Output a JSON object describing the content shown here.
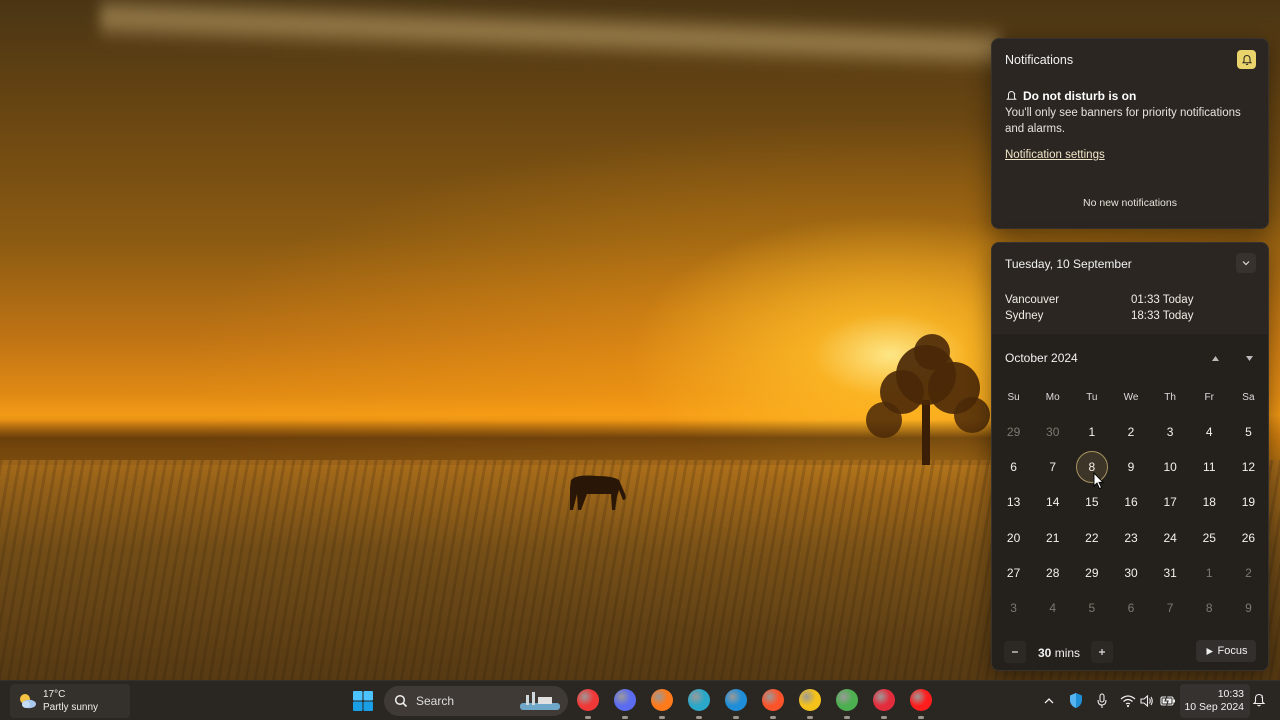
{
  "notifications": {
    "title": "Notifications",
    "dnd_heading": "Do not disturb is on",
    "dnd_description": "You'll only see banners for priority notifications and alarms.",
    "settings_link": "Notification settings",
    "empty_text": "No new notifications",
    "dnd_toggle_color": "#e9d36b"
  },
  "calendar": {
    "date_header": "Tuesday, 10 September",
    "clocks": [
      {
        "city": "Vancouver",
        "time": "01:33 Today"
      },
      {
        "city": "Sydney",
        "time": "18:33 Today"
      }
    ],
    "month_title": "October 2024",
    "weekdays": [
      "Su",
      "Mo",
      "Tu",
      "We",
      "Th",
      "Fr",
      "Sa"
    ],
    "weeks": [
      [
        {
          "d": "29",
          "m": true
        },
        {
          "d": "30",
          "m": true
        },
        {
          "d": "1"
        },
        {
          "d": "2"
        },
        {
          "d": "3"
        },
        {
          "d": "4"
        },
        {
          "d": "5"
        }
      ],
      [
        {
          "d": "6"
        },
        {
          "d": "7"
        },
        {
          "d": "8",
          "sel": true
        },
        {
          "d": "9"
        },
        {
          "d": "10"
        },
        {
          "d": "11"
        },
        {
          "d": "12"
        }
      ],
      [
        {
          "d": "13"
        },
        {
          "d": "14"
        },
        {
          "d": "15"
        },
        {
          "d": "16"
        },
        {
          "d": "17"
        },
        {
          "d": "18"
        },
        {
          "d": "19"
        }
      ],
      [
        {
          "d": "20"
        },
        {
          "d": "21"
        },
        {
          "d": "22"
        },
        {
          "d": "23"
        },
        {
          "d": "24"
        },
        {
          "d": "25"
        },
        {
          "d": "26"
        }
      ],
      [
        {
          "d": "27"
        },
        {
          "d": "28"
        },
        {
          "d": "29"
        },
        {
          "d": "30"
        },
        {
          "d": "31"
        },
        {
          "d": "1",
          "m": true
        },
        {
          "d": "2",
          "m": true
        }
      ],
      [
        {
          "d": "3",
          "m": true
        },
        {
          "d": "4",
          "m": true
        },
        {
          "d": "5",
          "m": true
        },
        {
          "d": "6",
          "m": true
        },
        {
          "d": "7",
          "m": true
        },
        {
          "d": "8",
          "m": true
        },
        {
          "d": "9",
          "m": true
        }
      ]
    ],
    "focus": {
      "value": "30",
      "unit": "mins",
      "button_label": "Focus"
    }
  },
  "taskbar": {
    "weather": {
      "temp": "17°C",
      "condition": "Partly sunny",
      "icon": "partly-sunny-icon"
    },
    "search_placeholder": "Search",
    "pinned_apps": [
      {
        "name": "vivaldi",
        "color": "#ef3939"
      },
      {
        "name": "firefox-dev",
        "color": "#5b6cf0"
      },
      {
        "name": "firefox",
        "color": "#ff7a1a"
      },
      {
        "name": "edge-dev",
        "color": "#2ba7c9"
      },
      {
        "name": "edge",
        "color": "#1f8ed8"
      },
      {
        "name": "brave",
        "color": "#fb542b"
      },
      {
        "name": "chrome-canary",
        "color": "#f4c21a"
      },
      {
        "name": "chrome",
        "color": "#4caf50"
      },
      {
        "name": "opera",
        "color": "#e32d3c"
      },
      {
        "name": "youtube-music",
        "color": "#ff1e1e"
      }
    ],
    "clock": {
      "time": "10:33",
      "date": "10 Sep 2024"
    }
  }
}
